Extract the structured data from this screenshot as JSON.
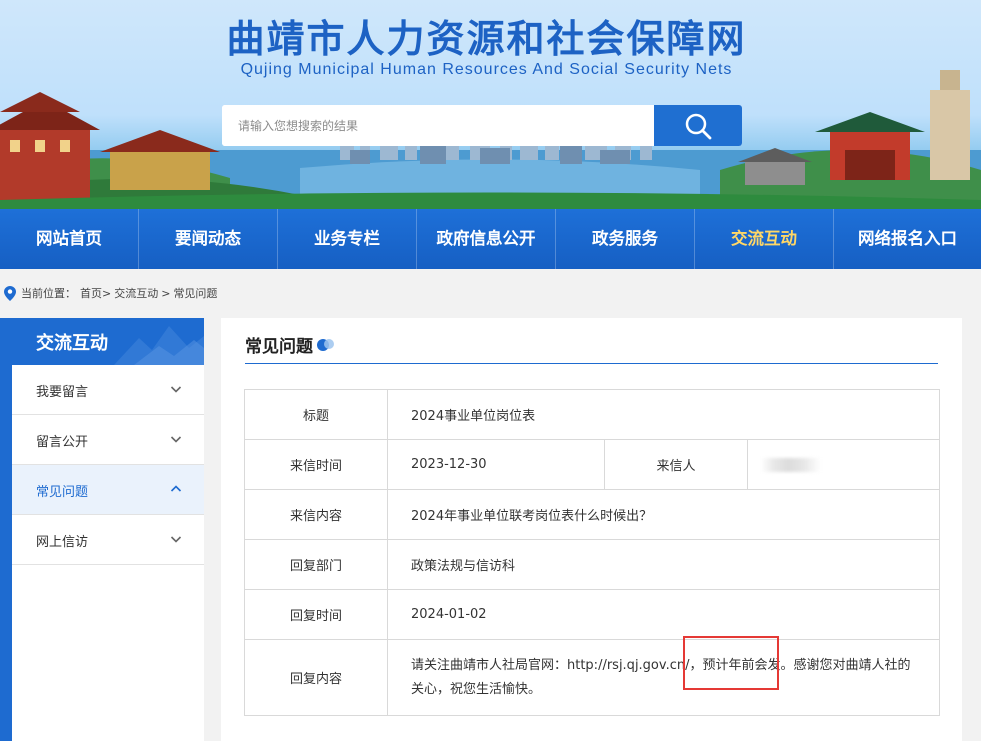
{
  "header": {
    "title": "曲靖市人力资源和社会保障网",
    "subtitle": "Qujing Municipal Human Resources And Social Security Nets",
    "search_placeholder": "请输入您想搜索的结果",
    "search_icon": "search-icon"
  },
  "nav": {
    "items": [
      {
        "label": "网站首页",
        "active": false
      },
      {
        "label": "要闻动态",
        "active": false
      },
      {
        "label": "业务专栏",
        "active": false
      },
      {
        "label": "政府信息公开",
        "active": false
      },
      {
        "label": "政务服务",
        "active": false
      },
      {
        "label": "交流互动",
        "active": true
      },
      {
        "label": "网络报名入口",
        "active": false
      }
    ]
  },
  "breadcrumb": {
    "prefix": "当前位置：",
    "home": "首页",
    "sep1": ">",
    "section": "交流互动",
    "sep2": ">",
    "current": "常见问题"
  },
  "sidebar": {
    "title": "交流互动",
    "items": [
      {
        "label": "我要留言",
        "expanded": false
      },
      {
        "label": "留言公开",
        "expanded": false
      },
      {
        "label": "常见问题",
        "expanded": true
      },
      {
        "label": "网上信访",
        "expanded": false
      }
    ]
  },
  "main": {
    "title": "常见问题",
    "rows": {
      "title_label": "标题",
      "title_value": "2024事业单位岗位表",
      "date_label": "来信时间",
      "date_value": "2023-12-30",
      "sender_label": "来信人",
      "content_label": "来信内容",
      "content_value": "2024年事业单位联考岗位表什么时候出？",
      "dept_label": "回复部门",
      "dept_value": "政策法规与信访科",
      "reply_date_label": "回复时间",
      "reply_date_value": "2024-01-02",
      "reply_label": "回复内容",
      "reply_value": "请关注曲靖市人社局官网：http://rsj.qj.gov.cn/，预计年前会发。感谢您对曲靖人社的关心，祝您生活愉快。"
    }
  },
  "colors": {
    "primary": "#1e6bd0",
    "nav_active": "#ffd766",
    "highlight": "#e53935"
  }
}
